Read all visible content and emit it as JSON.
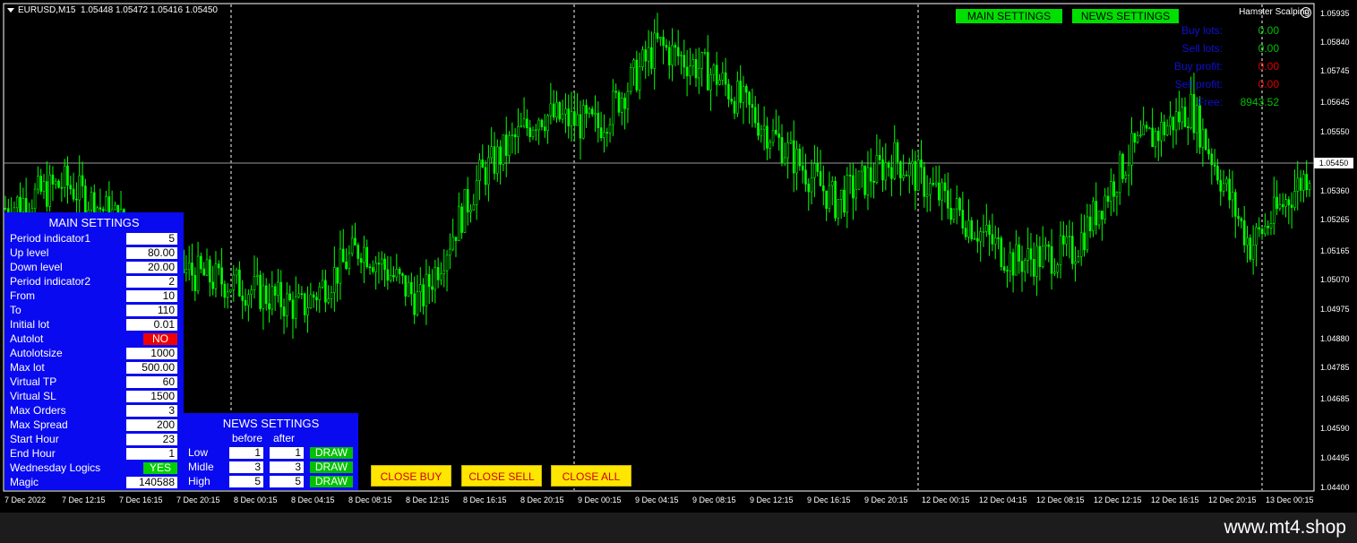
{
  "chart_header": {
    "symbol": "EURUSD,M15",
    "ohlc": "1.05448 1.05472 1.05416 1.05450"
  },
  "ea_name": "Hamster Scalping",
  "top_buttons": {
    "main": "MAIN SETTINGS",
    "news": "NEWS SETTINGS"
  },
  "stats": [
    {
      "label": "Buy lots:",
      "value": "0.00",
      "color": "#00c000"
    },
    {
      "label": "Sell lots:",
      "value": "0.00",
      "color": "#00c000"
    },
    {
      "label": "Buy profit:",
      "value": "0.00",
      "color": "#e00000"
    },
    {
      "label": "Sell profit:",
      "value": "0.00",
      "color": "#e00000"
    },
    {
      "label": "Free:",
      "value": "8943.52",
      "color": "#00c000"
    }
  ],
  "main_settings": {
    "title": "MAIN SETTINGS",
    "rows": [
      {
        "label": "Period indicator1",
        "value": "5"
      },
      {
        "label": "Up level",
        "value": "80.00"
      },
      {
        "label": "Down level",
        "value": "20.00"
      },
      {
        "label": "Period indicator2",
        "value": "2"
      },
      {
        "label": "From",
        "value": "10"
      },
      {
        "label": "To",
        "value": "110"
      },
      {
        "label": "Initial lot",
        "value": "0.01"
      },
      {
        "label": "Autolot",
        "value": "NO",
        "style": "red"
      },
      {
        "label": "Autolotsize",
        "value": "1000"
      },
      {
        "label": "Max lot",
        "value": "500.00"
      },
      {
        "label": "Virtual TP",
        "value": "60"
      },
      {
        "label": "Virtual SL",
        "value": "1500"
      },
      {
        "label": "Max Orders",
        "value": "3"
      },
      {
        "label": "Max Spread",
        "value": "200"
      },
      {
        "label": "Start Hour",
        "value": "23"
      },
      {
        "label": "End Hour",
        "value": "1"
      },
      {
        "label": "Wednesday Logics",
        "value": "YES",
        "style": "green"
      },
      {
        "label": "Magic",
        "value": "140588"
      }
    ]
  },
  "news_settings": {
    "title": "NEWS SETTINGS",
    "col_before": "before",
    "col_after": "after",
    "draw_label": "DRAW",
    "rows": [
      {
        "label": "Low",
        "before": "1",
        "after": "1"
      },
      {
        "label": "Midle",
        "before": "3",
        "after": "3"
      },
      {
        "label": "High",
        "before": "5",
        "after": "5"
      }
    ]
  },
  "action_buttons": {
    "close_buy": "CLOSE BUY",
    "close_sell": "CLOSE SELL",
    "close_all": "CLOSE ALL"
  },
  "current_price": "1.05450",
  "price_axis": [
    "1.05935",
    "1.05840",
    "1.05745",
    "1.05645",
    "1.05550",
    "1.05360",
    "1.05265",
    "1.05165",
    "1.05070",
    "1.04975",
    "1.04880",
    "1.04785",
    "1.04685",
    "1.04590",
    "1.04495",
    "1.04400"
  ],
  "time_axis": [
    "7 Dec 2022",
    "7 Dec 12:15",
    "7 Dec 16:15",
    "7 Dec 20:15",
    "8 Dec 00:15",
    "8 Dec 04:15",
    "8 Dec 08:15",
    "8 Dec 12:15",
    "8 Dec 16:15",
    "8 Dec 20:15",
    "9 Dec 00:15",
    "9 Dec 04:15",
    "9 Dec 08:15",
    "9 Dec 12:15",
    "9 Dec 16:15",
    "9 Dec 20:15",
    "12 Dec 00:15",
    "12 Dec 04:15",
    "12 Dec 08:15",
    "12 Dec 12:15",
    "12 Dec 16:15",
    "12 Dec 20:15",
    "13 Dec 00:15"
  ],
  "chart_data": {
    "type": "line",
    "title": "",
    "xlabel": "",
    "ylabel": "",
    "x": [
      "7 Dec 2022",
      "7 Dec 12:15",
      "7 Dec 16:15",
      "7 Dec 20:15",
      "8 Dec 00:15",
      "8 Dec 04:15",
      "8 Dec 08:15",
      "8 Dec 12:15",
      "8 Dec 16:15",
      "8 Dec 20:15",
      "9 Dec 00:15",
      "9 Dec 04:15",
      "9 Dec 08:15",
      "9 Dec 12:15",
      "9 Dec 16:15",
      "9 Dec 20:15",
      "12 Dec 00:15",
      "12 Dec 04:15",
      "12 Dec 08:15",
      "12 Dec 12:15",
      "12 Dec 16:15",
      "12 Dec 20:15",
      "13 Dec 00:15"
    ],
    "series": [
      {
        "values": [
          1.053,
          1.0538,
          1.0525,
          1.051,
          1.0505,
          1.0498,
          1.0518,
          1.05,
          1.054,
          1.056,
          1.0556,
          1.0582,
          1.0572,
          1.0552,
          1.0532,
          1.0546,
          1.053,
          1.0513,
          1.0516,
          1.0548,
          1.0562,
          1.0518,
          1.0542
        ]
      }
    ],
    "ylim": [
      1.044,
      1.0595
    ],
    "current_price": 1.0545,
    "grid": false,
    "color": "#00ff00"
  }
}
